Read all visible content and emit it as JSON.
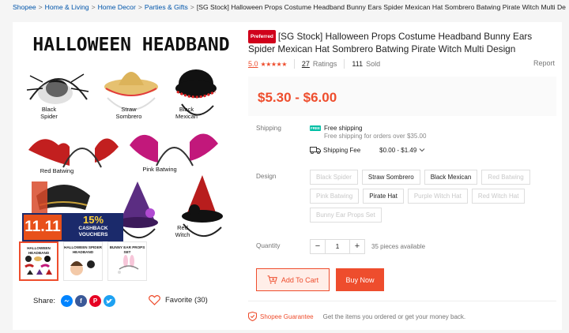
{
  "breadcrumb": {
    "items": [
      "Shopee",
      "Home & Living",
      "Home Decor",
      "Parties & Gifts"
    ],
    "current": "[SG Stock] Halloween Props Costume Headband Bunny Ears Spider Mexican Hat Sombrero Batwing Pirate Witch Multi Design",
    "separator": ">"
  },
  "gallery": {
    "hero_title": "HALLOWEEN HEADBAND",
    "labels": {
      "black_spider": "Black\nSpider",
      "straw_sombrero": "Straw\nSombrero",
      "black_mexican": "Black\nMexican",
      "red_batwing": "Red Batwing",
      "pink_batwing": "Pink Batwing",
      "red_witch": "Red\nWitch"
    },
    "promo": {
      "date": "11.11",
      "percent": "15%",
      "line1": "CASHBACK",
      "line2": "VOUCHERS"
    },
    "thumbs": [
      {
        "text": "HALLOWEEN HEADBAND"
      },
      {
        "text": "HALLOWEEN SPIDER HEADBAND"
      },
      {
        "text": "BUNNY EAR PROPS SET"
      }
    ]
  },
  "share": {
    "label": "Share:",
    "icons": [
      "messenger-icon",
      "facebook-icon",
      "pinterest-icon",
      "twitter-icon"
    ],
    "favorite_label": "Favorite (30)"
  },
  "product": {
    "badge": "Preferred",
    "title": "[SG Stock] Halloween Props Costume Headband Bunny Ears Spider Mexican Hat Sombrero Batwing Pirate Witch Multi Design",
    "rating": "5.0",
    "stars": 5,
    "ratings_count": "27",
    "ratings_label": "Ratings",
    "sold_count": "111",
    "sold_label": "Sold",
    "report": "Report",
    "price": "$5.30 - $6.00"
  },
  "shipping": {
    "label": "Shipping",
    "free_badge": "FREE",
    "free_label": "Free shipping",
    "free_sub": "Free shipping for orders over $35.00",
    "fee_label": "Shipping Fee",
    "fee_value": "$0.00 - $1.49"
  },
  "design": {
    "label": "Design",
    "options": [
      {
        "label": "Black Spider",
        "disabled": true
      },
      {
        "label": "Straw Sombrero",
        "disabled": false
      },
      {
        "label": "Black Mexican",
        "disabled": false
      },
      {
        "label": "Red Batwing",
        "disabled": true
      },
      {
        "label": "Pink Batwing",
        "disabled": true
      },
      {
        "label": "Pirate Hat",
        "disabled": false
      },
      {
        "label": "Purple Witch Hat",
        "disabled": true
      },
      {
        "label": "Red Witch Hat",
        "disabled": true
      },
      {
        "label": "Bunny Ear Props Set",
        "disabled": true
      }
    ]
  },
  "quantity": {
    "label": "Quantity",
    "minus": "−",
    "value": "1",
    "plus": "+",
    "available": "35 pieces available"
  },
  "actions": {
    "add_to_cart": "Add To Cart",
    "buy_now": "Buy Now"
  },
  "guarantee": {
    "label": "Shopee Guarantee",
    "text": "Get the items you ordered or get your money back."
  },
  "colors": {
    "accent": "#ee4d2d",
    "link": "#0055aa",
    "free_shipping": "#00bfa5"
  }
}
